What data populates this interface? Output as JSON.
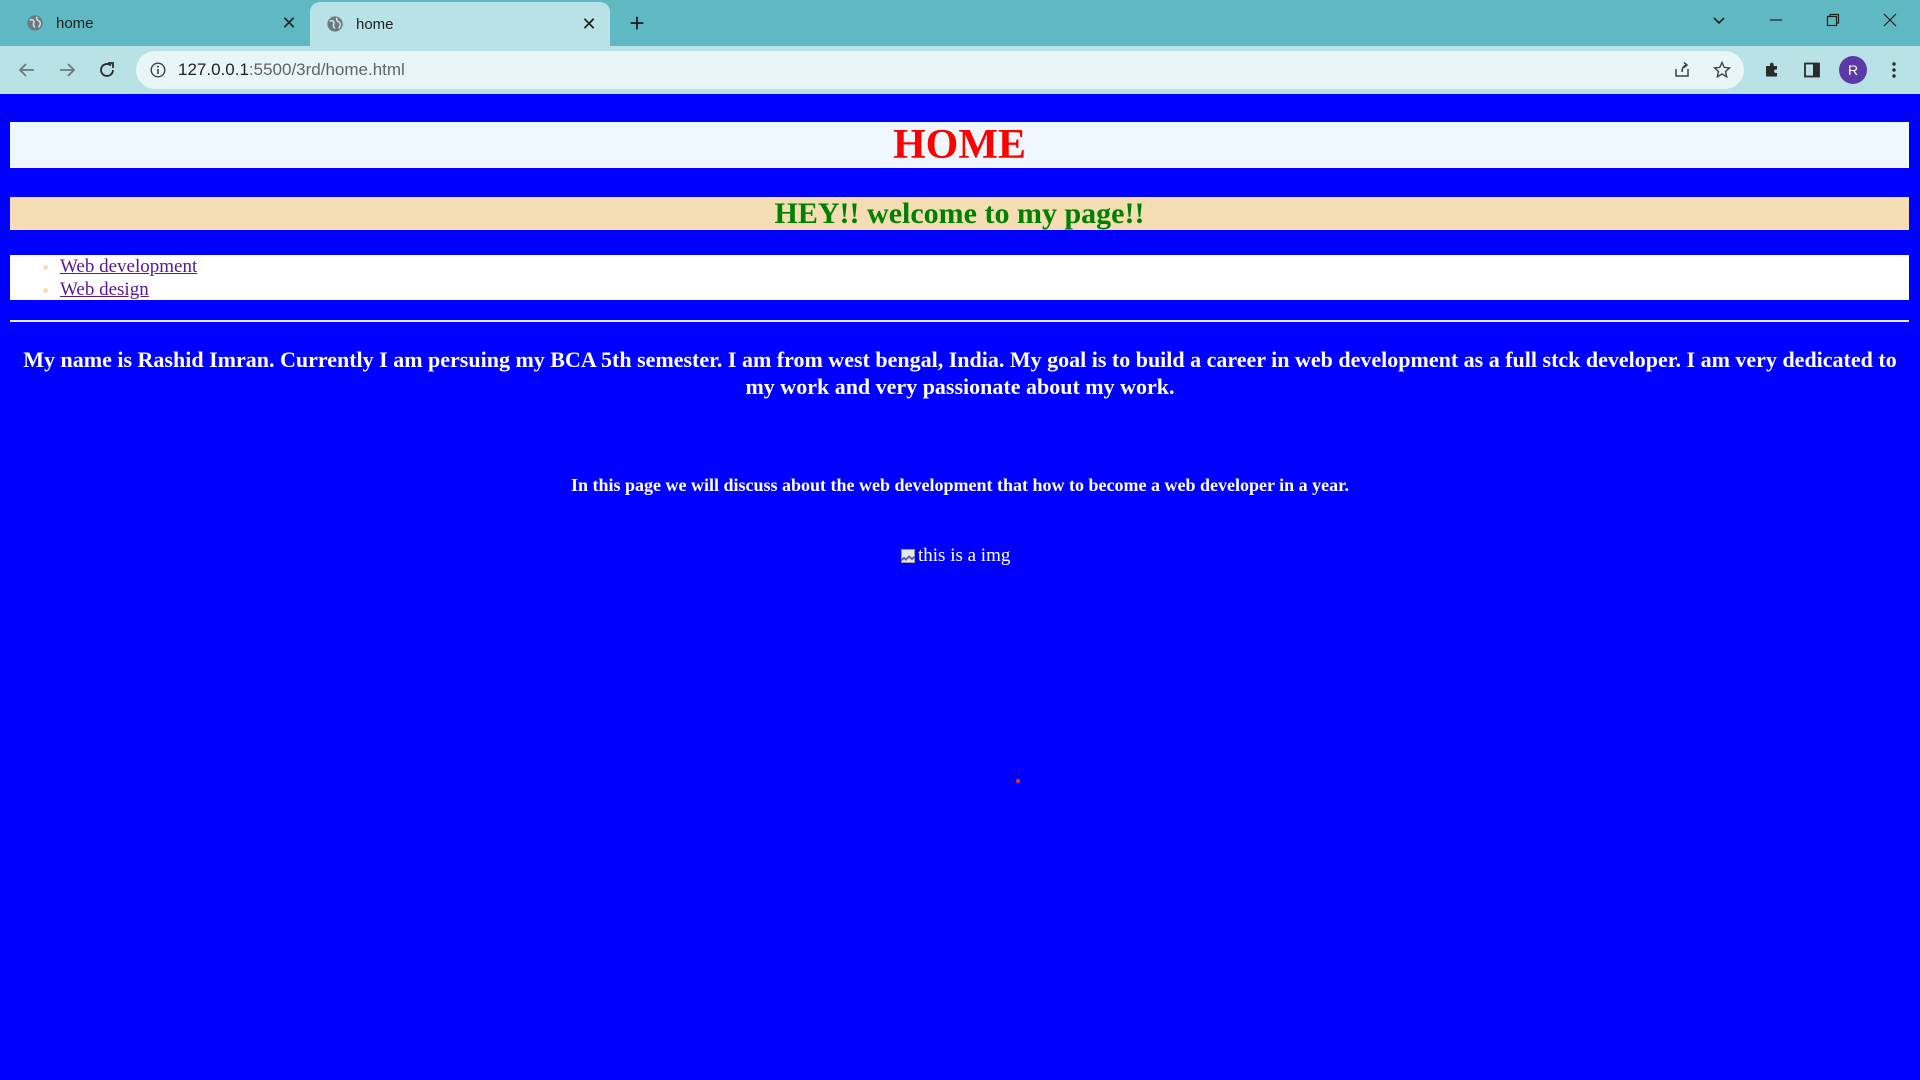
{
  "browser": {
    "tabs": [
      {
        "title": "home",
        "active": false
      },
      {
        "title": "home",
        "active": true
      }
    ],
    "url_host": "127.0.0.1",
    "url_path": ":5500/3rd/home.html",
    "profile_initial": "R"
  },
  "page": {
    "heading": "HOME",
    "welcome": "HEY!! welcome to my page!!",
    "nav_links": [
      {
        "label": "Web development"
      },
      {
        "label": "Web design"
      }
    ],
    "about": "My name is Rashid Imran. Currently I am persuing my BCA 5th semester. I am from west bengal, India. My goal is to build a career in web development as a full stck developer. I am very dedicated to my work and very passionate about my work.",
    "discuss": "In this page we will discuss about the web development that how to become a web developer in a year.",
    "image_alt": "this is a img"
  },
  "colors": {
    "page_background": "#0000ff",
    "heading_color": "#ff0000",
    "welcome_color": "#008000",
    "welcome_background": "#f5deb3",
    "heading_background": "#f0f8ff"
  }
}
